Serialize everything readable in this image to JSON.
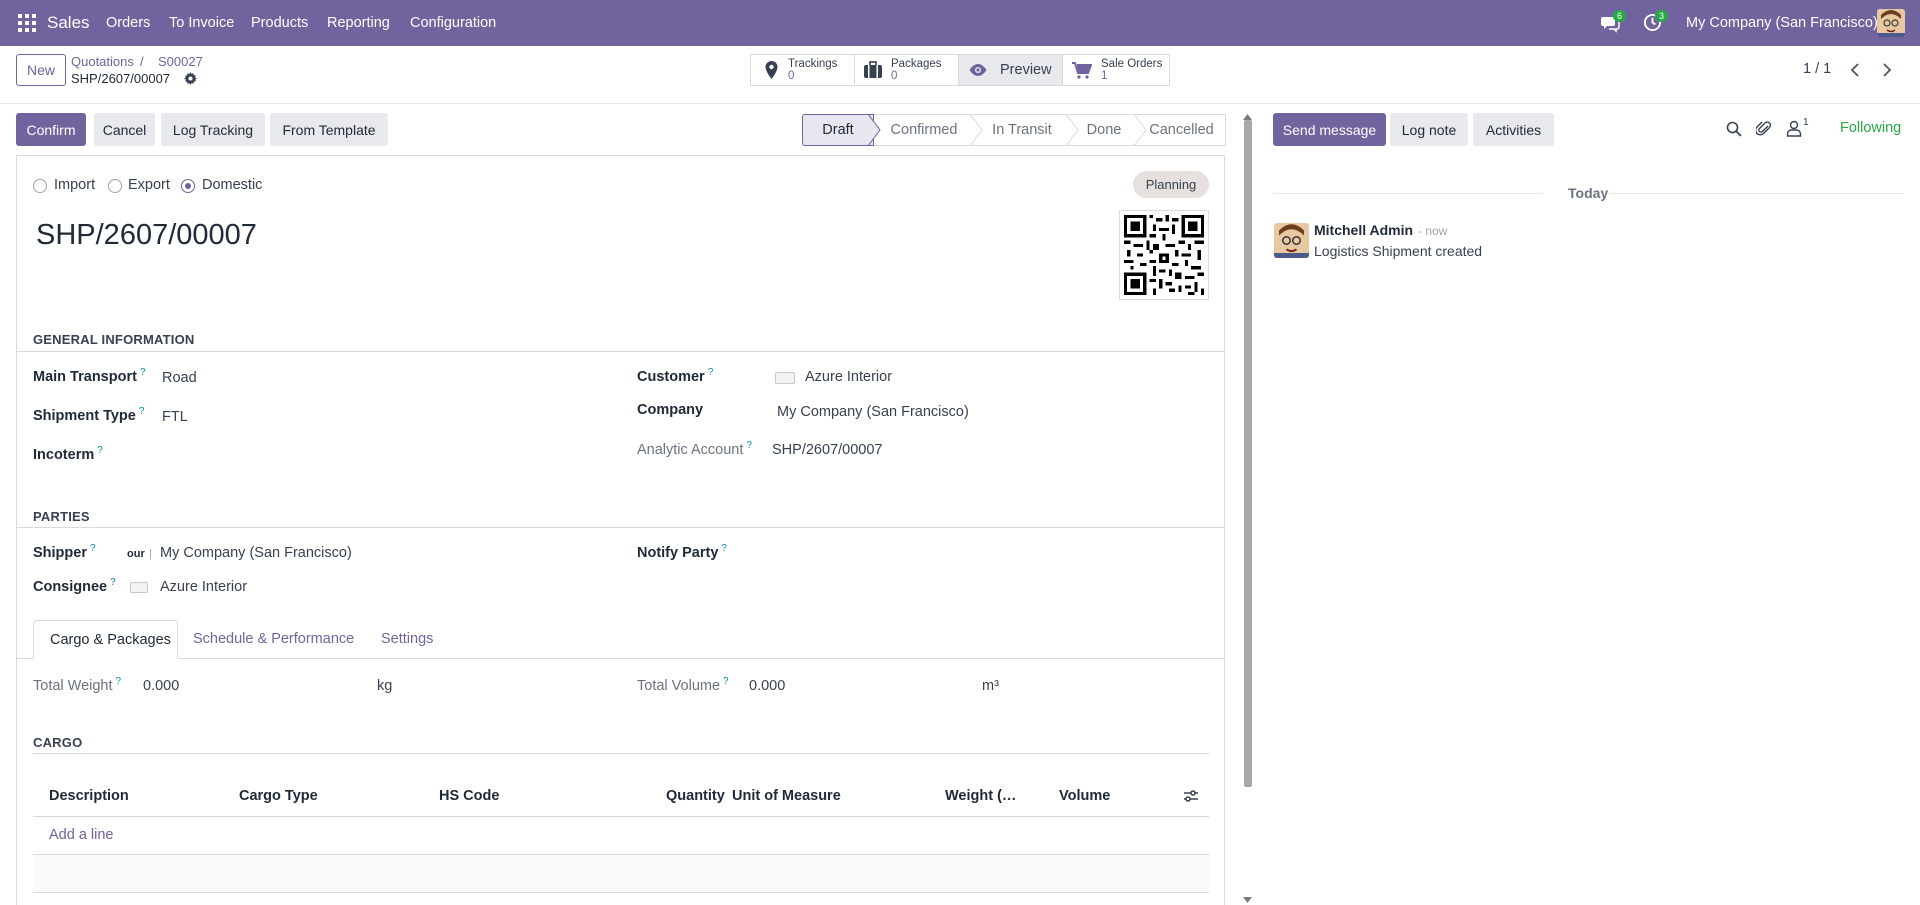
{
  "nav": {
    "app_name": "Sales",
    "menus": [
      "Orders",
      "To Invoice",
      "Products",
      "Reporting",
      "Configuration"
    ],
    "messages_count": "6",
    "activities_count": "3",
    "company": "My Company (San Francisco)"
  },
  "control": {
    "new_label": "New",
    "breadcrumb_parent": "Quotations",
    "breadcrumb_current": "S00027",
    "record_name": "SHP/2607/00007",
    "pager": "1 / 1"
  },
  "smart_buttons": {
    "trackings_label": "Trackings",
    "trackings_count": "0",
    "packages_label": "Packages",
    "packages_count": "0",
    "preview_label": "Preview",
    "sale_orders_label": "Sale Orders",
    "sale_orders_count": "1"
  },
  "actions": {
    "confirm": "Confirm",
    "cancel": "Cancel",
    "log_tracking": "Log Tracking",
    "from_template": "From Template"
  },
  "status": {
    "stages": [
      "Draft",
      "Confirmed",
      "In Transit",
      "Done",
      "Cancelled"
    ],
    "active": "Draft"
  },
  "form": {
    "direction": {
      "import": "Import",
      "export": "Export",
      "domestic": "Domestic",
      "selected": "Domestic"
    },
    "ribbon": "Planning",
    "title": "SHP/2607/00007",
    "general_info_title": "GENERAL INFORMATION",
    "main_transport_label": "Main Transport",
    "main_transport_value": "Road",
    "shipment_type_label": "Shipment Type",
    "shipment_type_value": "FTL",
    "incoterm_label": "Incoterm",
    "customer_label": "Customer",
    "customer_value": "Azure Interior",
    "company_label": "Company",
    "company_value": "My Company (San Francisco)",
    "analytic_label": "Analytic Account",
    "analytic_value": "SHP/2607/00007",
    "parties_title": "PARTIES",
    "shipper_label": "Shipper",
    "shipper_logo_text": "our",
    "shipper_value": "My Company (San Francisco)",
    "notify_label": "Notify Party",
    "consignee_label": "Consignee",
    "consignee_value": "Azure Interior",
    "help_mark": "?"
  },
  "tabs": [
    "Cargo & Packages",
    "Schedule & Performance",
    "Settings"
  ],
  "cargo": {
    "total_weight_label": "Total Weight",
    "total_weight_value": "0.000",
    "weight_unit": "kg",
    "total_volume_label": "Total Volume",
    "total_volume_value": "0.000",
    "volume_unit": "m³",
    "cargo_title": "CARGO",
    "columns": [
      "Description",
      "Cargo Type",
      "HS Code",
      "Quantity",
      "Unit of Measure",
      "Weight (…",
      "Volume"
    ],
    "add_line": "Add a line"
  },
  "chatter": {
    "send_message": "Send message",
    "log_note": "Log note",
    "activities": "Activities",
    "followers_count": "1",
    "following": "Following",
    "date_sep": "Today",
    "author": "Mitchell Admin",
    "time": "- now",
    "body": "Logistics Shipment created"
  },
  "colors": {
    "brand": "#71639e",
    "link": "#71639e",
    "success": "#28a745",
    "help": "#0a8ab5"
  }
}
